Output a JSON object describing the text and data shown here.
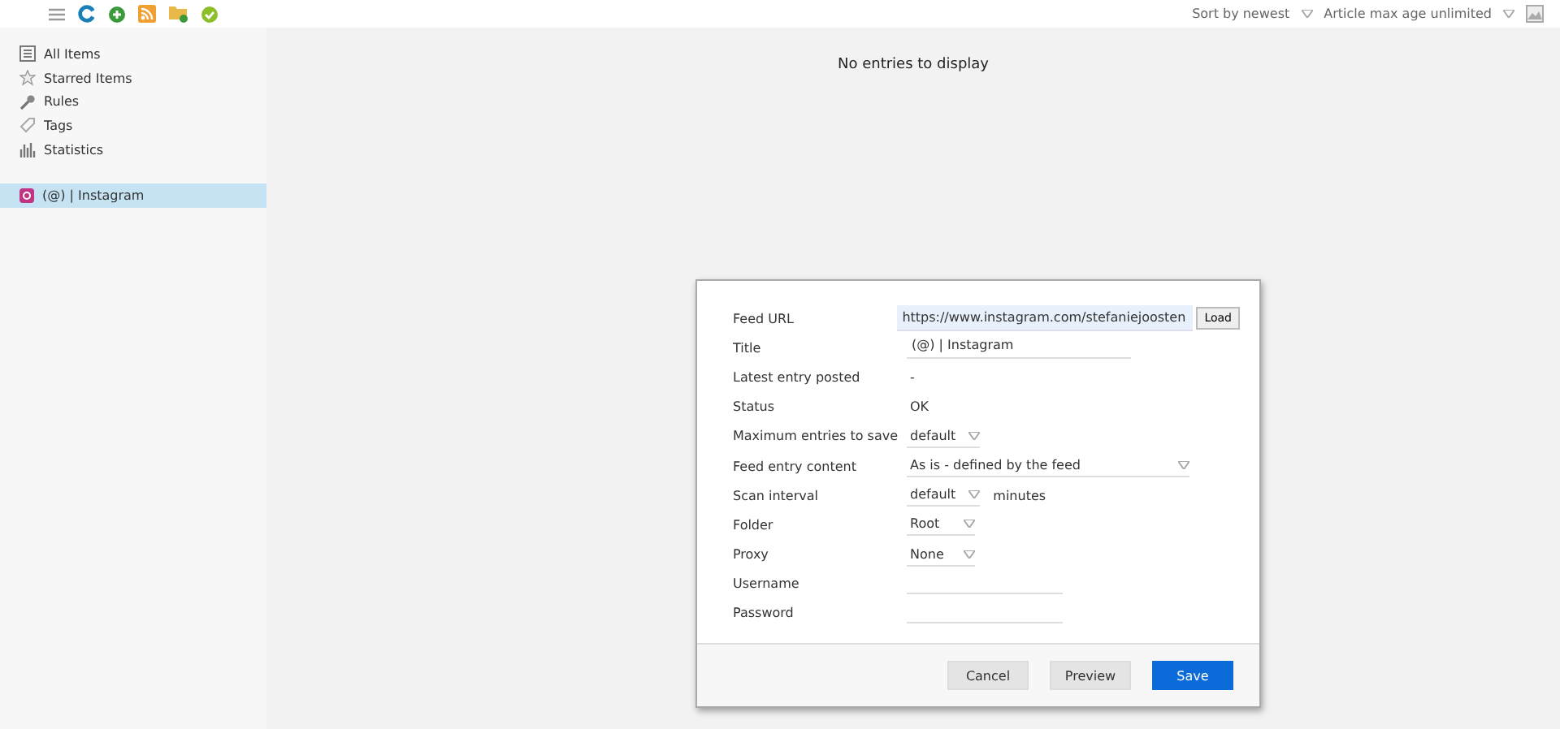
{
  "toolbar": {
    "sort": "Sort by newest",
    "max_age": "Article max age unlimited"
  },
  "sidebar": {
    "items": [
      {
        "label": "All Items"
      },
      {
        "label": "Starred Items"
      },
      {
        "label": "Rules"
      },
      {
        "label": "Tags"
      },
      {
        "label": "Statistics"
      }
    ],
    "feeds": [
      {
        "label": "(@) | Instagram",
        "selected": true
      }
    ]
  },
  "main": {
    "empty_message": "No entries to display"
  },
  "dialog": {
    "fields": [
      {
        "label": "Feed URL",
        "kind": "url",
        "value": "https://www.instagram.com/stefaniejoosten",
        "button": "Load"
      },
      {
        "label": "Title",
        "kind": "input",
        "value": "(@) | Instagram"
      },
      {
        "label": "Latest entry posted",
        "kind": "text",
        "value": "-"
      },
      {
        "label": "Status",
        "kind": "text",
        "value": "OK"
      },
      {
        "label": "Maximum entries to save",
        "kind": "select",
        "value": "default"
      },
      {
        "label": "Feed entry content",
        "kind": "wide-select",
        "value": "As is - defined by the feed"
      },
      {
        "label": "Scan interval",
        "kind": "select",
        "value": "default",
        "suffix": "minutes"
      },
      {
        "label": "Folder",
        "kind": "select",
        "value": "Root"
      },
      {
        "label": "Proxy",
        "kind": "select",
        "value": "None"
      },
      {
        "label": "Username",
        "kind": "input"
      },
      {
        "label": "Password",
        "kind": "input"
      }
    ],
    "buttons": [
      {
        "label": "Cancel",
        "primary": false
      },
      {
        "label": "Preview",
        "primary": false
      },
      {
        "label": "Save",
        "primary": true
      }
    ]
  }
}
